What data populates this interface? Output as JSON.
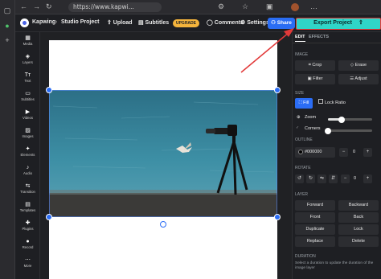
{
  "browser": {
    "url": "https://www.kapwi...",
    "sidebar_icons": [
      "tab-icon",
      "edge-icon",
      "add-icon"
    ]
  },
  "header": {
    "app_name": "Kapwing",
    "breadcrumb_sep": "›",
    "project_title": "Studio Project",
    "upload_label": "⇧ Upload",
    "subtitles_label": "▤ Subtitles",
    "upgrade_label": "UPGRADE",
    "comments_label": "◯ Comments",
    "settings_label": "⚙ Settings",
    "share_label": "⚇ Share",
    "export_label": "Export Project",
    "export_icon": "⇧"
  },
  "tools": [
    {
      "icon": "▦",
      "label": "Media"
    },
    {
      "icon": "◈",
      "label": "Layers"
    },
    {
      "icon": "Tт",
      "label": "Text"
    },
    {
      "icon": "▭",
      "label": "Subtitles"
    },
    {
      "icon": "▶",
      "label": "Videos"
    },
    {
      "icon": "▨",
      "label": "Images"
    },
    {
      "icon": "✦",
      "label": "Elements"
    },
    {
      "icon": "♪",
      "label": "Audio"
    },
    {
      "icon": "⇆",
      "label": "Transition"
    },
    {
      "icon": "▤",
      "label": "Templates"
    },
    {
      "icon": "✚",
      "label": "Plugins"
    },
    {
      "icon": "●",
      "label": "Record"
    },
    {
      "icon": "⋯",
      "label": "More"
    }
  ],
  "panel": {
    "tab_edit": "EDIT",
    "tab_effects": "EFFECTS",
    "image_section": "IMAGE",
    "crop_label": "⌗ Crop",
    "erase_label": "◇ Erase",
    "filter_label": "▣ Filter",
    "adjust_label": "☰ Adjust",
    "size_section": "SIZE",
    "fill_label": "⛶ Fill",
    "lock_ratio_label": "Lock Ratio",
    "zoom_label": "Zoom",
    "corners_label": "Corners",
    "zoom_value": 0.3,
    "corners_value": 0.0,
    "outline_section": "OUTLINE",
    "outline_color": "#000000",
    "outline_minus": "−",
    "outline_value": "0",
    "outline_plus": "+",
    "rotate_section": "ROTATE",
    "rotate_value": "0",
    "layer_section": "LAYER",
    "forward_label": "Forward",
    "backward_label": "Backward",
    "front_label": "Front",
    "back_label": "Back",
    "duplicate_label": "Duplicate",
    "lock_label": "Lock",
    "replace_label": "Replace",
    "delete_label": "Delete",
    "duration_section": "DURATION",
    "duration_hint": "Select a duration to update the duration of the image layer"
  },
  "colors": {
    "accent": "#2b6df5",
    "export_bg": "#30d5c8",
    "annotation_red": "#e23a3a",
    "upgrade": "#f5b43c"
  }
}
